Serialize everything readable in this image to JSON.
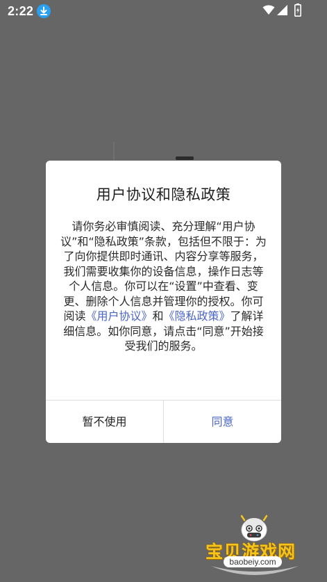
{
  "status_bar": {
    "time": "2:22",
    "icons": [
      "download-icon",
      "wifi-icon",
      "signal-icon",
      "battery-icon"
    ]
  },
  "dialog": {
    "title": "用户协议和隐私政策",
    "body_prefix": "请你务必审慎阅读、充分理解“用户协议”和“隐私政策”条款，包括但不限于：为了向你提供即时通讯、内容分享等服务，我们需要收集你的设备信息，操作日志等个人信息。你可以在“设置”中查看、变更、删除个人信息并管理你的授权。你可阅读",
    "link_user_agreement": "《用户协议》",
    "body_and": "和",
    "link_privacy_policy": "《隐私政策》",
    "body_suffix": "了解详细信息。如你同意，请点击“同意”开始接受我们的服务。",
    "decline_label": "暂不使用",
    "accept_label": "同意"
  },
  "watermark": {
    "text": "宝贝游戏网",
    "url": "baobeiy.com"
  },
  "colors": {
    "overlay": "#666666",
    "link": "#4a64c4",
    "watermark": "#f5c51b"
  }
}
